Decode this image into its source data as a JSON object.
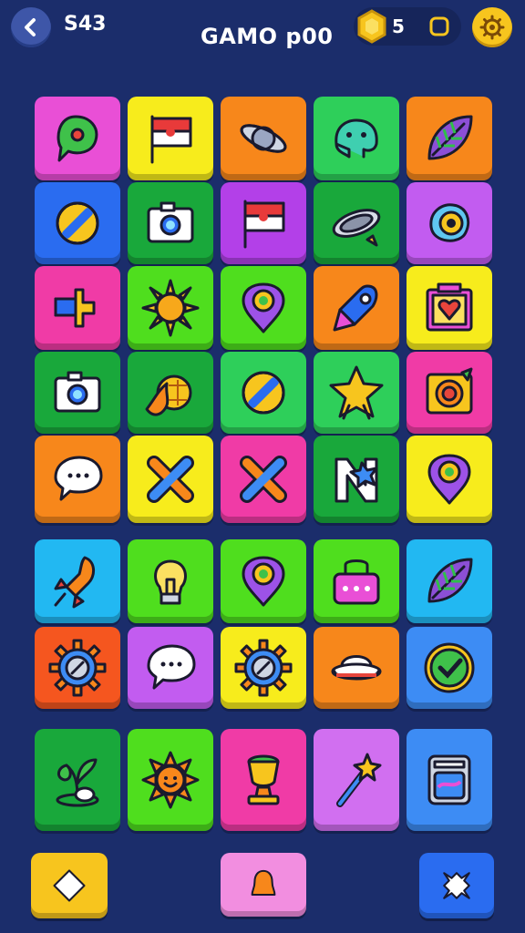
{
  "header": {
    "score_text": "S43",
    "title": "GAMO p00",
    "coins": "5"
  },
  "colors": {
    "background": "#1b2d6b",
    "pink": "#e94fd6",
    "yellow": "#f7ec1c",
    "orange": "#f7871b",
    "green": "#2ecf5a",
    "blue": "#2a6cf0",
    "purple": "#b340e8",
    "lime": "#4fde1e",
    "dkgreen": "#19a83b",
    "magenta": "#f03ba6",
    "red": "#f5561f",
    "cyan": "#22b8f2",
    "violet": "#c25cf0",
    "lavender": "#d16ff0",
    "lightblue": "#3d8cf4"
  },
  "grid": [
    [
      {
        "color": "pink",
        "icon": "chat-pin-icon"
      },
      {
        "color": "yellow",
        "icon": "flag-icon"
      },
      {
        "color": "orange",
        "icon": "ring-planet-icon"
      },
      {
        "color": "green",
        "icon": "blob-creature-icon"
      },
      {
        "color": "orange",
        "icon": "leaf-icon"
      }
    ],
    [
      {
        "color": "blue",
        "icon": "rocket-ring-icon"
      },
      {
        "color": "dkgreen",
        "icon": "camera-icon"
      },
      {
        "color": "purple",
        "icon": "flag-icon"
      },
      {
        "color": "dkgreen",
        "icon": "saturn-star-icon"
      },
      {
        "color": "violet",
        "icon": "egg-icon"
      }
    ],
    [
      {
        "color": "magenta",
        "icon": "block-shape-icon"
      },
      {
        "color": "lime",
        "icon": "sun-icon"
      },
      {
        "color": "lime",
        "icon": "location-pin-icon"
      },
      {
        "color": "orange",
        "icon": "rocket-icon"
      },
      {
        "color": "yellow",
        "icon": "heart-box-icon"
      }
    ],
    [
      {
        "color": "dkgreen",
        "icon": "camera-icon"
      },
      {
        "color": "dkgreen",
        "icon": "fire-planet-icon"
      },
      {
        "color": "green",
        "icon": "rocket-ring-icon"
      },
      {
        "color": "green",
        "icon": "star-icon"
      },
      {
        "color": "magenta",
        "icon": "bug-box-icon"
      }
    ],
    [
      {
        "color": "orange",
        "icon": "speech-bubble-icon"
      },
      {
        "color": "yellow",
        "icon": "x-mark-icon"
      },
      {
        "color": "magenta",
        "icon": "x-mark-icon"
      },
      {
        "color": "dkgreen",
        "icon": "letter-n-icon"
      },
      {
        "color": "yellow",
        "icon": "location-pin-icon"
      }
    ],
    [
      {
        "color": "cyan",
        "icon": "rocket-launch-icon"
      },
      {
        "color": "lime",
        "icon": "lightbulb-icon"
      },
      {
        "color": "lime",
        "icon": "location-pin-icon"
      },
      {
        "color": "lime",
        "icon": "bag-icon"
      },
      {
        "color": "cyan",
        "icon": "leaf-icon"
      }
    ],
    [
      {
        "color": "red",
        "icon": "gear-icon"
      },
      {
        "color": "violet",
        "icon": "speech-bubble-icon"
      },
      {
        "color": "yellow",
        "icon": "gear-icon"
      },
      {
        "color": "orange",
        "icon": "hat-icon"
      },
      {
        "color": "lightblue",
        "icon": "check-icon"
      }
    ],
    [
      {
        "color": "dkgreen",
        "icon": "sprout-icon"
      },
      {
        "color": "lime",
        "icon": "sun-face-icon"
      },
      {
        "color": "magenta",
        "icon": "trophy-icon"
      },
      {
        "color": "lavender",
        "icon": "magic-wand-icon"
      },
      {
        "color": "lightblue",
        "icon": "washing-machine-icon"
      }
    ]
  ],
  "bottom_bar": [
    {
      "name": "diamond-button",
      "icon": "diamond-icon",
      "color": "#f7c51e"
    },
    {
      "name": "bell-button",
      "icon": "bell-icon",
      "color": "#f28ee0"
    },
    {
      "name": "shuffle-button",
      "icon": "shuffle-icon",
      "color": "#2a6cf0"
    }
  ]
}
